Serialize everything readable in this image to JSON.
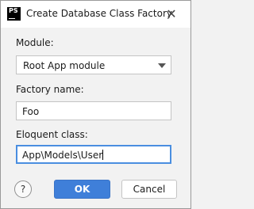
{
  "window": {
    "title": "Create Database Class Factory",
    "app_icon_text": "PS",
    "close_glyph": "✕"
  },
  "form": {
    "module_label": "Module:",
    "module_value": "Root App module",
    "factory_name_label": "Factory name:",
    "factory_name_value": "Foo",
    "eloquent_class_label": "Eloquent class:",
    "eloquent_class_value": "App\\Models\\User"
  },
  "buttons": {
    "help": "?",
    "ok": "OK",
    "cancel": "Cancel"
  },
  "colors": {
    "accent": "#3f7fd9",
    "focus_border": "#4a8ee0"
  }
}
